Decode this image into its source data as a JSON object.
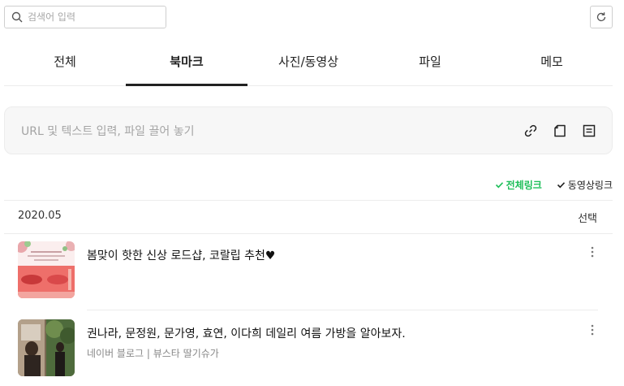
{
  "search": {
    "placeholder": "검색어 입력",
    "value": ""
  },
  "tabs": [
    {
      "label": "전체"
    },
    {
      "label": "북마크"
    },
    {
      "label": "사진/동영상"
    },
    {
      "label": "파일"
    },
    {
      "label": "메모"
    }
  ],
  "dropzone": {
    "placeholder": "URL 및 텍스트 입력, 파일 끌어 놓기"
  },
  "filters": [
    {
      "label": "전체링크"
    },
    {
      "label": "동영상링크"
    }
  ],
  "list": {
    "date": "2020.05",
    "select_label": "선택",
    "items": [
      {
        "title": "봄맞이 핫한 신상 로드샵, 코랄립 추천♥",
        "source": ""
      },
      {
        "title": "권나라, 문정원, 문가영, 효연, 이다희 데일리 여름 가방을 알아보자.",
        "source": "네이버 블로그 | 뷰스타 딸기슈가"
      }
    ]
  },
  "colors": {
    "accent": "#1fbf5a",
    "active_tab_bar": "#222222"
  }
}
